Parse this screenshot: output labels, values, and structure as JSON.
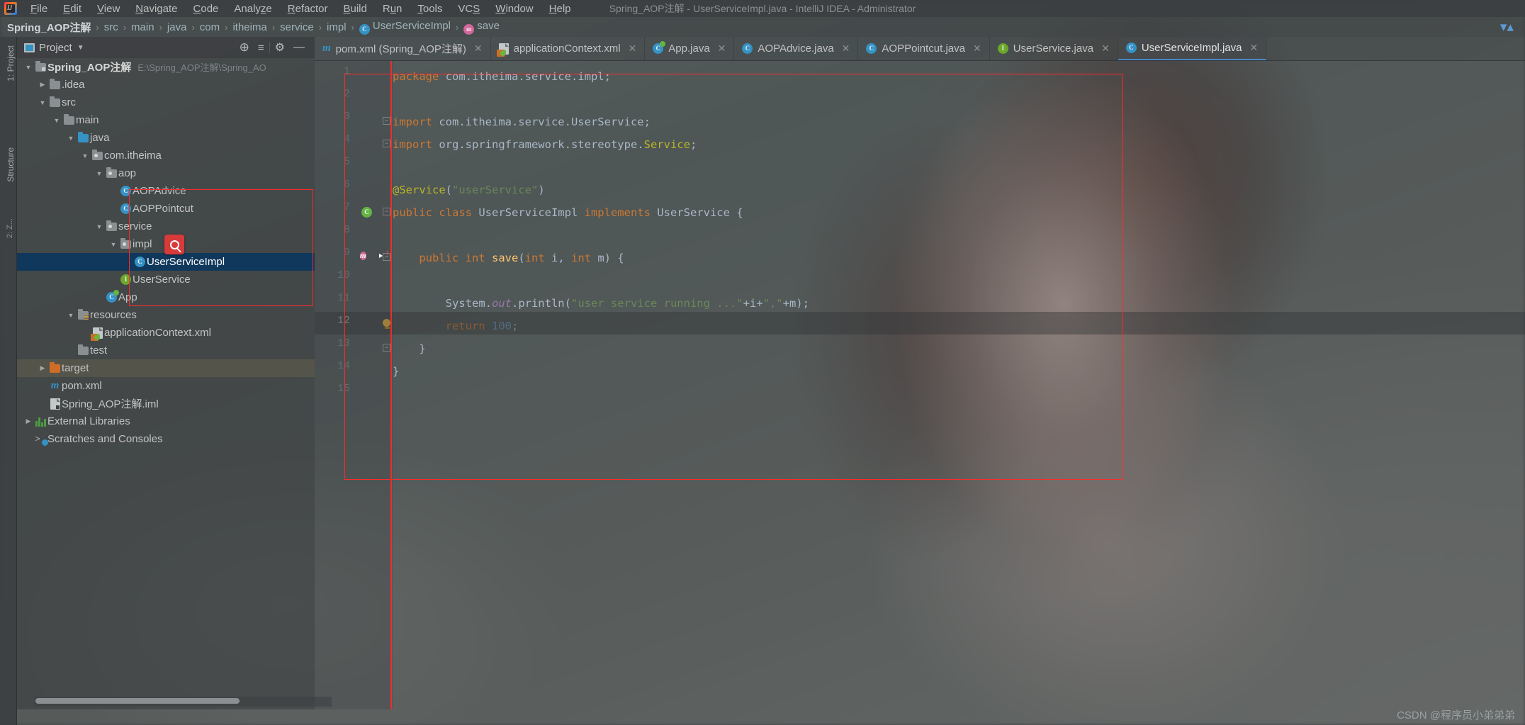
{
  "window": {
    "title": "Spring_AOP注解 - UserServiceImpl.java - IntelliJ IDEA - Administrator"
  },
  "menubar": {
    "logo_icon": "intellij-idea-logo",
    "items": [
      {
        "label": "File"
      },
      {
        "label": "Edit"
      },
      {
        "label": "View"
      },
      {
        "label": "Navigate"
      },
      {
        "label": "Code"
      },
      {
        "label": "Analyze"
      },
      {
        "label": "Refactor"
      },
      {
        "label": "Build"
      },
      {
        "label": "Run"
      },
      {
        "label": "Tools"
      },
      {
        "label": "VCS"
      },
      {
        "label": "Window"
      },
      {
        "label": "Help"
      }
    ]
  },
  "breadcrumb": {
    "separator": "›",
    "items": [
      {
        "label": "Spring_AOP注解",
        "icon": ""
      },
      {
        "label": "src",
        "icon": ""
      },
      {
        "label": "main",
        "icon": ""
      },
      {
        "label": "java",
        "icon": ""
      },
      {
        "label": "com",
        "icon": ""
      },
      {
        "label": "itheima",
        "icon": ""
      },
      {
        "label": "service",
        "icon": ""
      },
      {
        "label": "impl",
        "icon": ""
      },
      {
        "label": "UserServiceImpl",
        "icon": "class-icon"
      },
      {
        "label": "save",
        "icon": "method-icon"
      }
    ],
    "collapse_icon": "chevron-collapse-icon"
  },
  "left_strip": {
    "project_tab": "1: Project",
    "structure_tab": "Structure",
    "z_tab": "2: Z..."
  },
  "project_panel": {
    "title": "Project",
    "dropdown_icon": "chevron-down-icon",
    "window_icon": "project-window-icon",
    "toolbar": [
      {
        "name": "locate-icon",
        "glyph": "⊕"
      },
      {
        "name": "collapse-all-icon",
        "glyph": "≡"
      },
      {
        "name": "settings-gear-icon",
        "glyph": "⚙"
      },
      {
        "name": "hide-icon",
        "glyph": "—"
      }
    ],
    "tree": [
      {
        "indent": 0,
        "arrow": "down",
        "icon": "module-folder-icon",
        "label": "Spring_AOP注解",
        "sub": "E:\\Spring_AOP注解\\Spring_AO",
        "bold": true,
        "state": "normal"
      },
      {
        "indent": 1,
        "arrow": "right",
        "icon": "folder-icon",
        "label": ".idea",
        "sub": "",
        "bold": false,
        "state": "normal"
      },
      {
        "indent": 1,
        "arrow": "down",
        "icon": "folder-icon",
        "label": "src",
        "sub": "",
        "bold": false,
        "state": "normal"
      },
      {
        "indent": 2,
        "arrow": "down",
        "icon": "folder-icon",
        "label": "main",
        "sub": "",
        "bold": false,
        "state": "normal"
      },
      {
        "indent": 3,
        "arrow": "down",
        "icon": "source-folder-icon",
        "label": "java",
        "sub": "",
        "bold": false,
        "state": "normal"
      },
      {
        "indent": 4,
        "arrow": "down",
        "icon": "package-icon",
        "label": "com.itheima",
        "sub": "",
        "bold": false,
        "state": "normal"
      },
      {
        "indent": 5,
        "arrow": "down",
        "icon": "package-icon",
        "label": "aop",
        "sub": "",
        "bold": false,
        "state": "normal"
      },
      {
        "indent": 6,
        "arrow": "none",
        "icon": "class-icon",
        "label": "AOPAdvice",
        "sub": "",
        "bold": false,
        "state": "normal"
      },
      {
        "indent": 6,
        "arrow": "none",
        "icon": "class-icon",
        "label": "AOPPointcut",
        "sub": "",
        "bold": false,
        "state": "normal"
      },
      {
        "indent": 5,
        "arrow": "down",
        "icon": "package-icon",
        "label": "service",
        "sub": "",
        "bold": false,
        "state": "normal"
      },
      {
        "indent": 6,
        "arrow": "down",
        "icon": "package-icon",
        "label": "impl",
        "sub": "",
        "bold": false,
        "state": "normal"
      },
      {
        "indent": 7,
        "arrow": "none",
        "icon": "class-icon",
        "label": "UserServiceImpl",
        "sub": "",
        "bold": false,
        "state": "selected"
      },
      {
        "indent": 6,
        "arrow": "none",
        "icon": "interface-icon",
        "label": "UserService",
        "sub": "",
        "bold": false,
        "state": "normal"
      },
      {
        "indent": 5,
        "arrow": "none",
        "icon": "runnable-class-icon",
        "label": "App",
        "sub": "",
        "bold": false,
        "state": "normal"
      },
      {
        "indent": 3,
        "arrow": "down",
        "icon": "resources-folder-icon",
        "label": "resources",
        "sub": "",
        "bold": false,
        "state": "normal"
      },
      {
        "indent": 4,
        "arrow": "none",
        "icon": "spring-xml-icon",
        "label": "applicationContext.xml",
        "sub": "",
        "bold": false,
        "state": "normal"
      },
      {
        "indent": 3,
        "arrow": "none",
        "icon": "folder-icon",
        "label": "test",
        "sub": "",
        "bold": false,
        "state": "normal"
      },
      {
        "indent": 1,
        "arrow": "right",
        "icon": "excluded-folder-icon",
        "label": "target",
        "sub": "",
        "bold": false,
        "state": "hovered"
      },
      {
        "indent": 1,
        "arrow": "none",
        "icon": "maven-icon",
        "label": "pom.xml",
        "sub": "",
        "bold": false,
        "state": "normal"
      },
      {
        "indent": 1,
        "arrow": "none",
        "icon": "iml-icon",
        "label": "Spring_AOP注解.iml",
        "sub": "",
        "bold": false,
        "state": "normal"
      },
      {
        "indent": 0,
        "arrow": "right",
        "icon": "libraries-icon",
        "label": "External Libraries",
        "sub": "",
        "bold": false,
        "state": "normal"
      },
      {
        "indent": 0,
        "arrow": "none",
        "icon": "scratches-icon",
        "label": "Scratches and Consoles",
        "sub": "",
        "bold": false,
        "state": "normal"
      }
    ]
  },
  "editor_tabs": [
    {
      "label": "pom.xml (Spring_AOP注解)",
      "icon": "maven-icon",
      "active": false,
      "close_icon": "close-icon"
    },
    {
      "label": "applicationContext.xml",
      "icon": "spring-xml-icon",
      "active": false,
      "close_icon": "close-icon"
    },
    {
      "label": "App.java",
      "icon": "runnable-class-icon",
      "active": false,
      "close_icon": "close-icon"
    },
    {
      "label": "AOPAdvice.java",
      "icon": "class-icon",
      "active": false,
      "close_icon": "close-icon"
    },
    {
      "label": "AOPPointcut.java",
      "icon": "class-icon",
      "active": false,
      "close_icon": "close-icon"
    },
    {
      "label": "UserService.java",
      "icon": "interface-icon",
      "active": false,
      "close_icon": "close-icon"
    },
    {
      "label": "UserServiceImpl.java",
      "icon": "class-icon",
      "active": true,
      "close_icon": "close-icon"
    }
  ],
  "editor": {
    "line_numbers": [
      "1",
      "2",
      "3",
      "4",
      "5",
      "6",
      "7",
      "8",
      "9",
      "10",
      "11",
      "12",
      "13",
      "14",
      "15"
    ],
    "current_line": "12",
    "lines": [
      {
        "n": 1,
        "tokens": [
          {
            "t": "package ",
            "c": "kw"
          },
          {
            "t": "com.itheima.service.impl;",
            "c": "pln"
          }
        ]
      },
      {
        "n": 2,
        "tokens": []
      },
      {
        "n": 3,
        "tokens": [
          {
            "t": "import ",
            "c": "kw"
          },
          {
            "t": "com.itheima.service.UserService;",
            "c": "pln"
          }
        ]
      },
      {
        "n": 4,
        "tokens": [
          {
            "t": "import ",
            "c": "kw"
          },
          {
            "t": "org.springframework.stereotype.",
            "c": "pln"
          },
          {
            "t": "Service",
            "c": "ann"
          },
          {
            "t": ";",
            "c": "pln"
          }
        ]
      },
      {
        "n": 5,
        "tokens": []
      },
      {
        "n": 6,
        "tokens": [
          {
            "t": "@Service",
            "c": "ann"
          },
          {
            "t": "(",
            "c": "pln"
          },
          {
            "t": "\"userService\"",
            "c": "str"
          },
          {
            "t": ")",
            "c": "pln"
          }
        ]
      },
      {
        "n": 7,
        "tokens": [
          {
            "t": "public class ",
            "c": "kw"
          },
          {
            "t": "UserServiceImpl ",
            "c": "cls"
          },
          {
            "t": "implements ",
            "c": "kw"
          },
          {
            "t": "UserService {",
            "c": "cls"
          }
        ]
      },
      {
        "n": 8,
        "tokens": []
      },
      {
        "n": 9,
        "tokens": [
          {
            "t": "    ",
            "c": "pln"
          },
          {
            "t": "public int ",
            "c": "kw"
          },
          {
            "t": "save",
            "c": "mth"
          },
          {
            "t": "(",
            "c": "pln"
          },
          {
            "t": "int",
            "c": "kw"
          },
          {
            "t": " i, ",
            "c": "pln"
          },
          {
            "t": "int",
            "c": "kw"
          },
          {
            "t": " m) {",
            "c": "pln"
          }
        ]
      },
      {
        "n": 10,
        "tokens": []
      },
      {
        "n": 11,
        "tokens": [
          {
            "t": "        System.",
            "c": "pln"
          },
          {
            "t": "out",
            "c": "fld"
          },
          {
            "t": ".println(",
            "c": "pln"
          },
          {
            "t": "\"user service running ...\"",
            "c": "str"
          },
          {
            "t": "+i+",
            "c": "pln"
          },
          {
            "t": "\",\"",
            "c": "str"
          },
          {
            "t": "+m);",
            "c": "pln"
          }
        ]
      },
      {
        "n": 12,
        "tokens": [
          {
            "t": "        ",
            "c": "pln"
          },
          {
            "t": "return ",
            "c": "kw"
          },
          {
            "t": "100",
            "c": "num"
          },
          {
            "t": ";",
            "c": "pln"
          }
        ]
      },
      {
        "n": 13,
        "tokens": [
          {
            "t": "    }",
            "c": "pln"
          }
        ]
      },
      {
        "n": 14,
        "tokens": [
          {
            "t": "}",
            "c": "pln"
          }
        ]
      },
      {
        "n": 15,
        "tokens": []
      }
    ],
    "gutter_markers": [
      {
        "line": 7,
        "name": "spring-bean-gutter-icon"
      },
      {
        "line": 9,
        "name": "method-gutter-icon"
      },
      {
        "line": 9,
        "name": "implements-override-gutter-icon"
      },
      {
        "line": 12,
        "name": "intention-bulb-icon"
      }
    ]
  },
  "annotations": {
    "tree_box_label": "red-highlight-rectangle-tree",
    "editor_box_label": "red-highlight-rectangle-editor",
    "search_badge_icon": "search-icon"
  },
  "watermark": "CSDN @程序员小弟弟弟"
}
